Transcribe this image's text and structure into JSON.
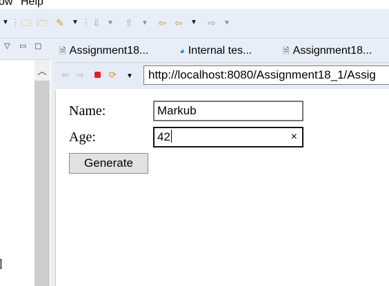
{
  "menu": {
    "items": [
      "ow",
      "Help"
    ]
  },
  "toolbar": {
    "icons": [
      "dropdown-arrow",
      "open-folder-icon",
      "folder-icon",
      "pin-icon",
      "dropdown-arrow",
      "separator",
      "next-annotation-icon",
      "dropdown-arrow",
      "prev-annotation-icon",
      "dropdown-arrow",
      "last-edit-icon",
      "back-icon",
      "dropdown-arrow",
      "forward-icon",
      "dropdown-arrow"
    ]
  },
  "left_view": {
    "bracket_text": "]"
  },
  "editor_tabs": [
    {
      "label": "Assignment18...",
      "icon": "file-icon"
    },
    {
      "label": "Internal tes...",
      "icon": "globe-icon"
    },
    {
      "label": "Assignment18...",
      "icon": "file-icon"
    }
  ],
  "browser": {
    "url": "http://localhost:8080/Assignment18_1/Assig"
  },
  "form": {
    "name_label": "Name:",
    "name_value": "Markub",
    "age_label": "Age:",
    "age_value": "42",
    "clear_glyph": "×",
    "submit_label": "Generate"
  },
  "colors": {
    "toolbar_bg": "#e8eef8",
    "stop_red": "#e02020",
    "refresh_orange": "#d59a17"
  }
}
